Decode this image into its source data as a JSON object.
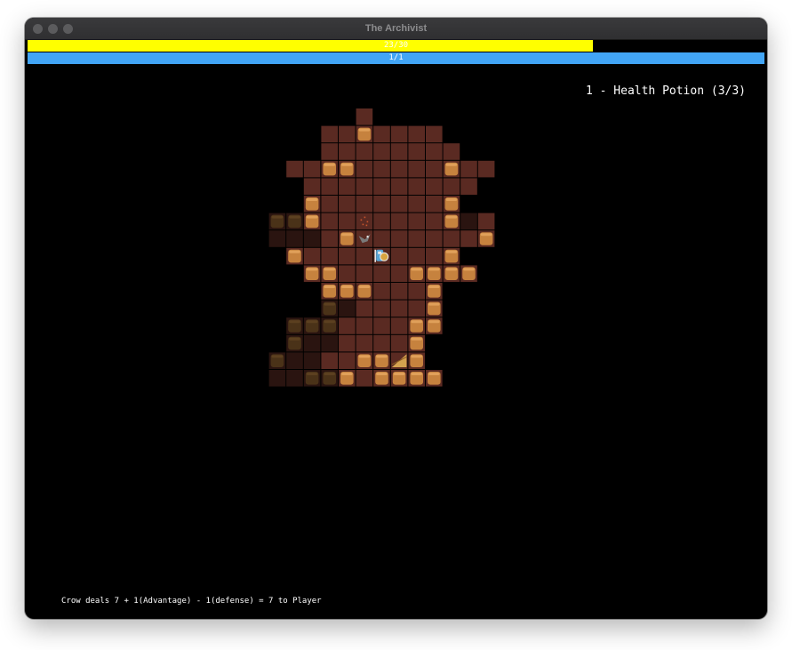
{
  "window": {
    "title": "The Archivist"
  },
  "hud": {
    "health": {
      "text": "23/30",
      "fraction": 0.7667,
      "color": "#ffff00"
    },
    "mana": {
      "text": "1/1",
      "fraction": 1.0,
      "color": "#42a5f5"
    }
  },
  "hotbar": {
    "item": "1 - Health Potion (3/3)"
  },
  "message_log": {
    "latest": "Crow deals 7 + 1(Advantage) - 1(defense) = 7 to Player"
  },
  "colors": {
    "background": "#000000",
    "floor_visible": "#5a2a22",
    "floor_explored": "#2a1410",
    "wall_visible": "#c6823e",
    "wall_explored": "#4a3218",
    "stairs": "#d4a24f",
    "player": "#58a6d6",
    "enemy": "#7a7a7a"
  },
  "dungeon": {
    "legend": {
      "F": "floor (visible)",
      "D": "floor (explored)",
      "W": "wall (visible)",
      "X": "wall (explored)",
      "S": "stairs down",
      ".": "unexplored"
    },
    "rows": [
      "......F.....",
      "....FFWFFFF.",
      "....FFFFFFFF.",
      "..FFWWFFFFFWFF",
      "...FFFFFFFFFF",
      "...WFFFFFFFW",
      ".XXWFFFFFFFWDF",
      ".DDDFWFFFFFFFW",
      "..WFFFFFFFFW",
      "...WWFFFFWWWW",
      "....WWWFFFW",
      "....XDFFFFW",
      "..XXXFFFFWW",
      "..XDDFFFFW",
      ".XDDFFWWSW",
      ".DDXXWFWWWW"
    ],
    "entities": [
      {
        "name": "Player",
        "icon": "player-knight-icon",
        "col": 7,
        "row": 8
      },
      {
        "name": "Crow",
        "icon": "crow-icon",
        "col": 6,
        "row": 7
      },
      {
        "name": "Fire Sparks",
        "icon": "sparks-icon",
        "col": 6,
        "row": 6
      }
    ]
  }
}
